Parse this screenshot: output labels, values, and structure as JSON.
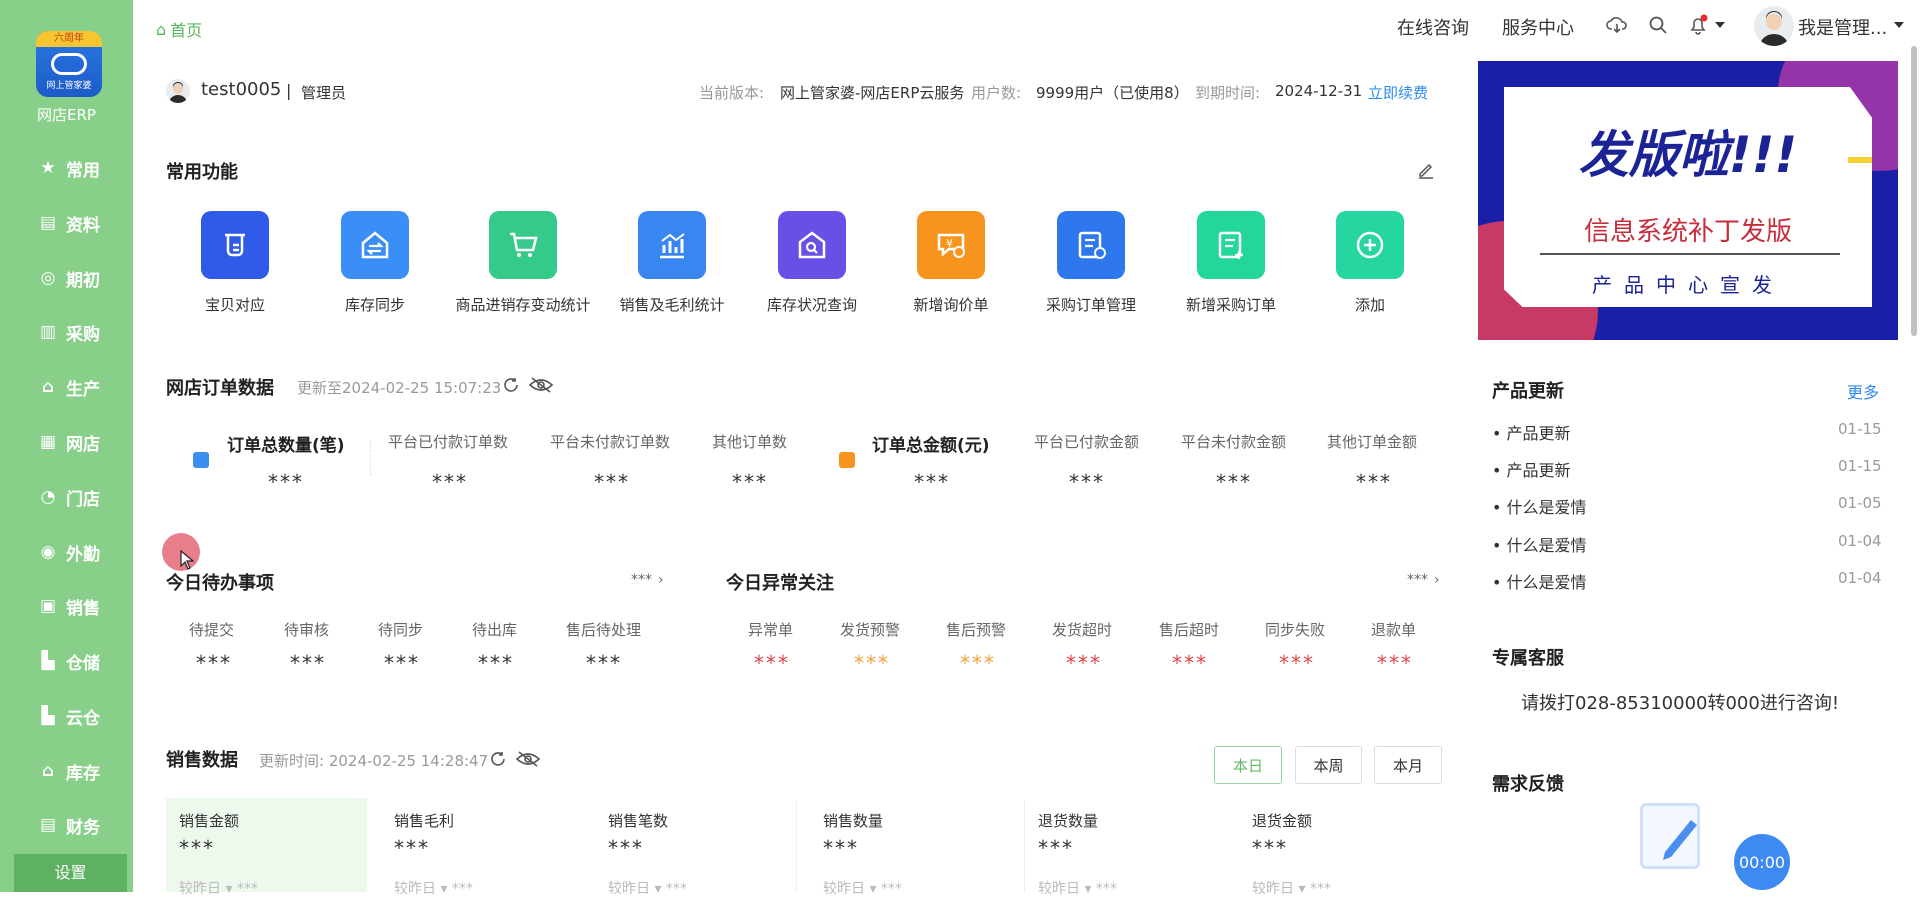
{
  "sidebar": {
    "logo_badge": "六周年",
    "logo_sub": "网上管家婆",
    "app_name": "网店ERP",
    "items": [
      {
        "label": "常用",
        "icon": "star-icon"
      },
      {
        "label": "资料",
        "icon": "document-icon"
      },
      {
        "label": "期初",
        "icon": "target-icon"
      },
      {
        "label": "采购",
        "icon": "purchase-icon"
      },
      {
        "label": "生产",
        "icon": "production-icon"
      },
      {
        "label": "网店",
        "icon": "store-icon"
      },
      {
        "label": "门店",
        "icon": "pie-icon"
      },
      {
        "label": "外勤",
        "icon": "field-icon"
      },
      {
        "label": "销售",
        "icon": "sales-chart-icon"
      },
      {
        "label": "仓储",
        "icon": "warehouse-icon"
      },
      {
        "label": "云仓",
        "icon": "cloud-warehouse-icon"
      },
      {
        "label": "库存",
        "icon": "inventory-icon"
      },
      {
        "label": "财务",
        "icon": "finance-icon"
      }
    ],
    "settings_label": "设置"
  },
  "header": {
    "breadcrumb": "首页",
    "online_consult": "在线咨询",
    "service_center": "服务中心",
    "user_name": "我是管理..."
  },
  "account": {
    "name": "test0005",
    "separator": "|",
    "role": "管理员",
    "version_label": "当前版本:",
    "version_value": "网上管家婆-网店ERP云服务",
    "users_label": "用户数:",
    "users_value": "9999用户（已使用8）",
    "expire_label": "到期时间:",
    "expire_value": "2024-12-31",
    "renew_link": "立即续费"
  },
  "quick": {
    "title": "常用功能",
    "items": [
      {
        "label": "宝贝对应",
        "color": "#2f5be8"
      },
      {
        "label": "库存同步",
        "color": "#3b8ef5"
      },
      {
        "label": "商品进销存变动统计",
        "color": "#35c98a"
      },
      {
        "label": "销售及毛利统计",
        "color": "#3a86f0"
      },
      {
        "label": "库存状况查询",
        "color": "#6a4fe6"
      },
      {
        "label": "新增询价单",
        "color": "#f7941d"
      },
      {
        "label": "采购订单管理",
        "color": "#2e77ee"
      },
      {
        "label": "新增采购订单",
        "color": "#23d69a"
      },
      {
        "label": "添加",
        "color": "#25d6a0"
      }
    ]
  },
  "orders": {
    "title": "网店订单数据",
    "updated": "更新至2024-02-25 15:07:23",
    "count_title": "订单总数量(笔)",
    "count_value": "***",
    "count_items": [
      {
        "label": "平台已付款订单数",
        "value": "***"
      },
      {
        "label": "平台未付款订单数",
        "value": "***"
      },
      {
        "label": "其他订单数",
        "value": "***"
      }
    ],
    "amount_title": "订单总金额(元)",
    "amount_value": "***",
    "amount_items": [
      {
        "label": "平台已付款金额",
        "value": "***"
      },
      {
        "label": "平台未付款金额",
        "value": "***"
      },
      {
        "label": "其他订单金额",
        "value": "***"
      }
    ]
  },
  "todo": {
    "title": "今日待办事项",
    "more": "***",
    "items": [
      {
        "label": "待提交",
        "value": "***"
      },
      {
        "label": "待审核",
        "value": "***"
      },
      {
        "label": "待同步",
        "value": "***"
      },
      {
        "label": "待出库",
        "value": "***"
      },
      {
        "label": "售后待处理",
        "value": "***"
      }
    ]
  },
  "alerts": {
    "title": "今日异常关注",
    "more": "***",
    "items": [
      {
        "label": "异常单",
        "value": "***",
        "color": "#e0454a"
      },
      {
        "label": "发货预警",
        "value": "***",
        "color": "#f0a33a"
      },
      {
        "label": "售后预警",
        "value": "***",
        "color": "#f0a33a"
      },
      {
        "label": "发货超时",
        "value": "***",
        "color": "#e0454a"
      },
      {
        "label": "售后超时",
        "value": "***",
        "color": "#e0454a"
      },
      {
        "label": "同步失败",
        "value": "***",
        "color": "#e0454a"
      },
      {
        "label": "退款单",
        "value": "***",
        "color": "#e0454a"
      }
    ]
  },
  "sales": {
    "title": "销售数据",
    "updated": "更新时间: 2024-02-25 14:28:47",
    "periods": [
      "本日",
      "本周",
      "本月"
    ],
    "cards": [
      {
        "label": "销售金额",
        "value": "***",
        "compare": "较昨日 ▾ ***"
      },
      {
        "label": "销售毛利",
        "value": "***",
        "compare": "较昨日 ▾ ***"
      },
      {
        "label": "销售笔数",
        "value": "***",
        "compare": "较昨日 ▾ ***"
      },
      {
        "label": "销售数量",
        "value": "***",
        "compare": "较昨日 ▾ ***"
      },
      {
        "label": "退货数量",
        "value": "***",
        "compare": "较昨日 ▾ ***"
      },
      {
        "label": "退货金额",
        "value": "***",
        "compare": "较昨日 ▾ ***"
      }
    ]
  },
  "banner": {
    "headline": "发版啦!!!",
    "subtitle": "信息系统补丁发版",
    "footer": "产品中心宣发"
  },
  "updates": {
    "title": "产品更新",
    "more": "更多",
    "items": [
      {
        "label": "产品更新",
        "date": "01-15"
      },
      {
        "label": "产品更新",
        "date": "01-15"
      },
      {
        "label": "什么是爱情",
        "date": "01-05"
      },
      {
        "label": "什么是爱情",
        "date": "01-04"
      },
      {
        "label": "什么是爱情",
        "date": "01-04"
      }
    ]
  },
  "service": {
    "title": "专属客服",
    "text": "请拨打028-85310000转000进行咨询!"
  },
  "feedback": {
    "title": "需求反馈"
  },
  "timer": "00:00"
}
